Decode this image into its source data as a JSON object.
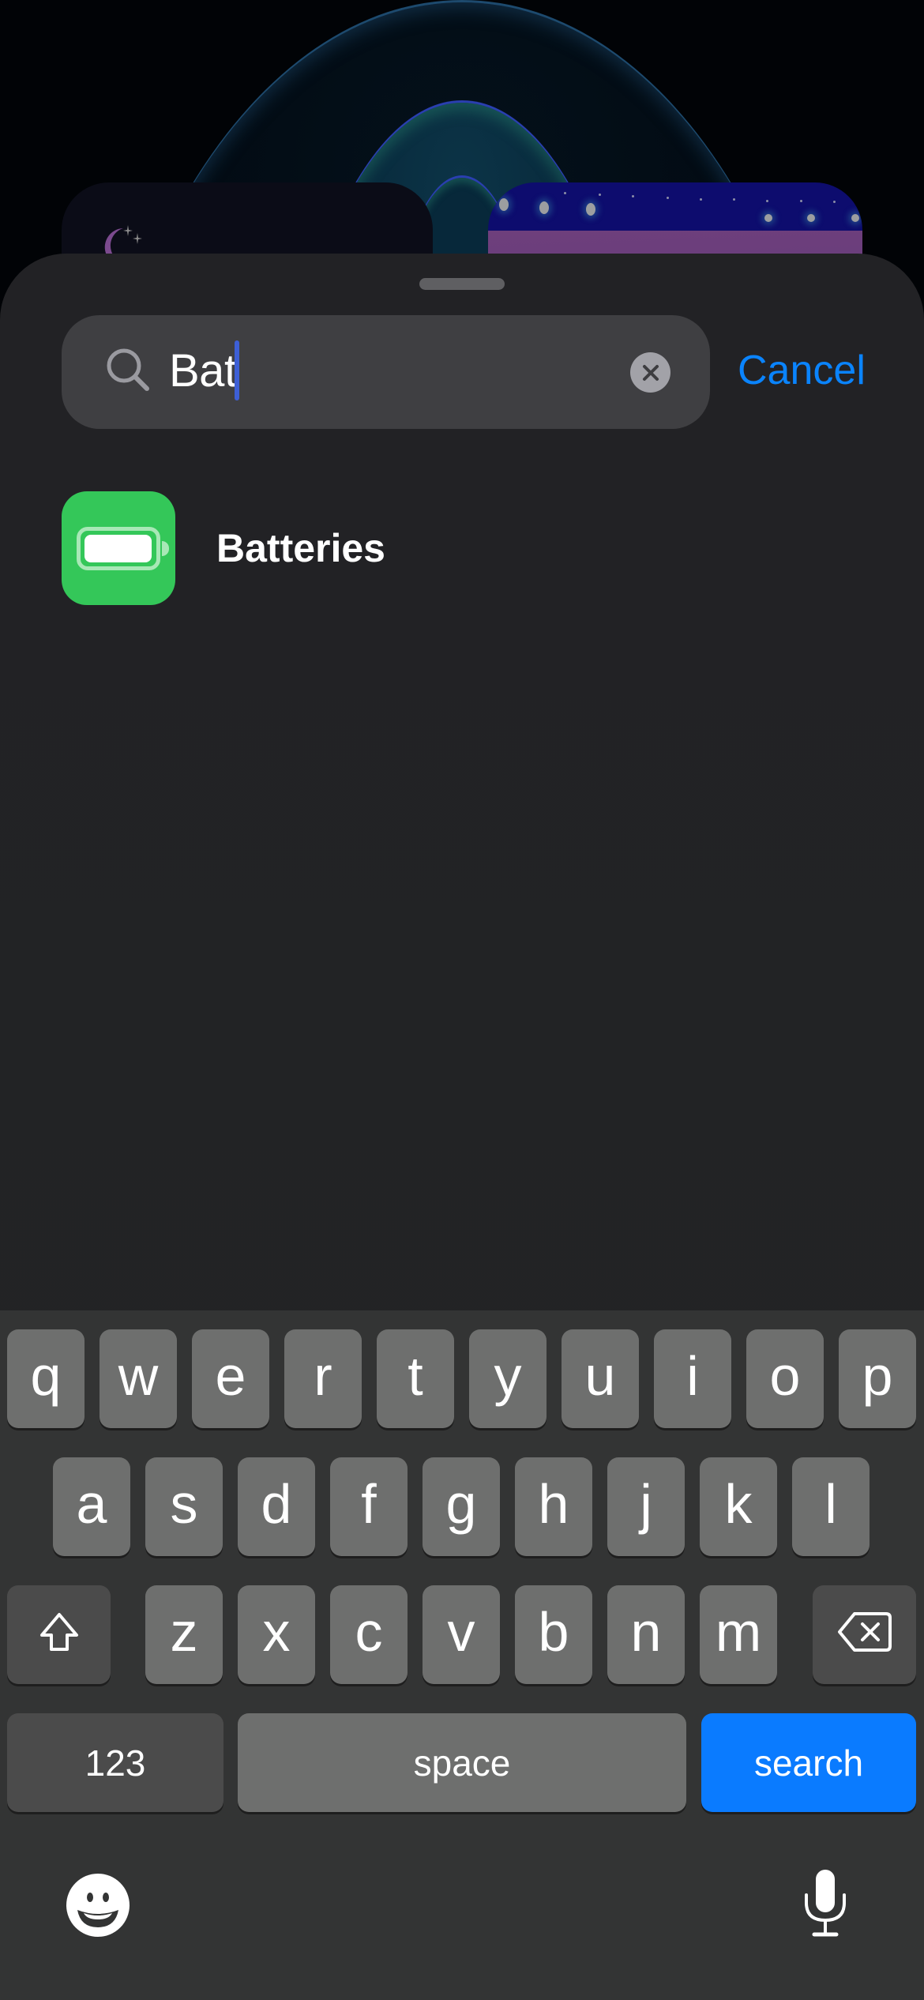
{
  "search": {
    "query": "Bat",
    "cancel_label": "Cancel"
  },
  "results": [
    {
      "name": "Batteries",
      "icon": "battery-icon",
      "icon_color": "#34c759"
    }
  ],
  "keyboard": {
    "row1": [
      "q",
      "w",
      "e",
      "r",
      "t",
      "y",
      "u",
      "i",
      "o",
      "p"
    ],
    "row2": [
      "a",
      "s",
      "d",
      "f",
      "g",
      "h",
      "j",
      "k",
      "l"
    ],
    "row3": [
      "z",
      "x",
      "c",
      "v",
      "b",
      "n",
      "m"
    ],
    "shift_icon": "shift-icon",
    "delete_icon": "delete-icon",
    "numbers_label": "123",
    "space_label": "space",
    "return_label": "search",
    "emoji_icon": "emoji-icon",
    "mic_icon": "microphone-icon"
  },
  "colors": {
    "accent": "#0a84ff",
    "return_key": "#0a7bff",
    "cursor": "#3d5fd6"
  }
}
